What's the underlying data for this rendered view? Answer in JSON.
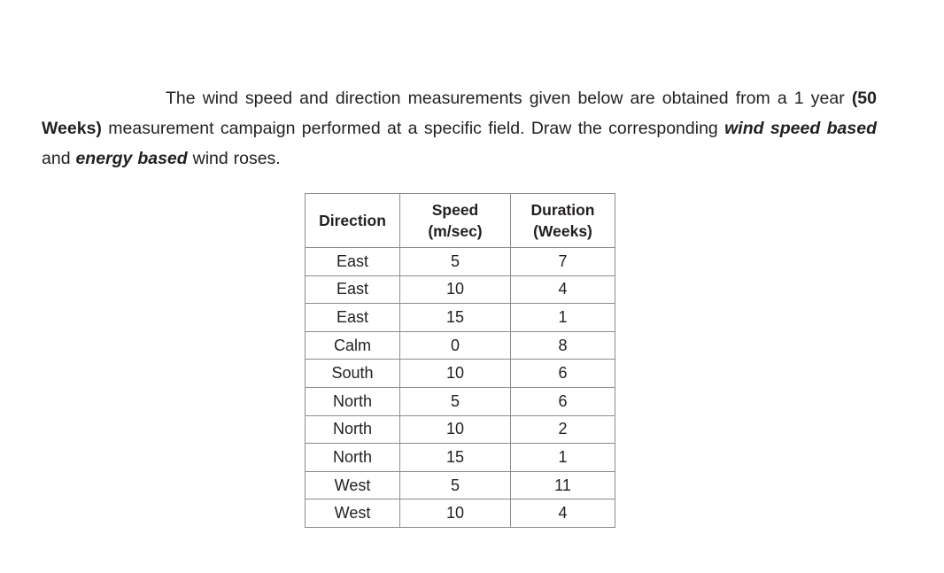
{
  "question": {
    "segments": [
      {
        "text": "The wind speed and direction measurements given below are obtained from a 1 year ",
        "style": "normal"
      },
      {
        "text": "(50 Weeks)",
        "style": "bold"
      },
      {
        "text": " measurement campaign performed at a specific field. Draw the corresponding ",
        "style": "normal"
      },
      {
        "text": "wind speed based",
        "style": "bold-italic"
      },
      {
        "text": " and ",
        "style": "normal"
      },
      {
        "text": "energy based",
        "style": "bold-italic"
      },
      {
        "text": " wind roses.",
        "style": "normal"
      }
    ],
    "part1": "The wind speed and direction measurements given below are obtained from a 1 year ",
    "bold1": "(50 Weeks)",
    "part2": " measurement campaign performed at a specific field. Draw the corresponding ",
    "bolditalic1": "wind speed based",
    "part3": " and ",
    "bolditalic2": "energy based",
    "part4": " wind roses."
  },
  "table": {
    "headers": [
      {
        "line1": "Direction",
        "line2": ""
      },
      {
        "line1": "Speed",
        "line2": "(m/sec)"
      },
      {
        "line1": "Duration",
        "line2": "(Weeks)"
      }
    ],
    "rows": [
      {
        "direction": "East",
        "speed": "5",
        "duration": "7"
      },
      {
        "direction": "East",
        "speed": "10",
        "duration": "4"
      },
      {
        "direction": "East",
        "speed": "15",
        "duration": "1"
      },
      {
        "direction": "Calm",
        "speed": "0",
        "duration": "8"
      },
      {
        "direction": "South",
        "speed": "10",
        "duration": "6"
      },
      {
        "direction": "North",
        "speed": "5",
        "duration": "6"
      },
      {
        "direction": "North",
        "speed": "10",
        "duration": "2"
      },
      {
        "direction": "North",
        "speed": "15",
        "duration": "1"
      },
      {
        "direction": "West",
        "speed": "5",
        "duration": "11"
      },
      {
        "direction": "West",
        "speed": "10",
        "duration": "4"
      }
    ]
  },
  "colors": {
    "page_background": "#ffffff",
    "text": "#231f20",
    "table_border": "#8c8c8c"
  }
}
